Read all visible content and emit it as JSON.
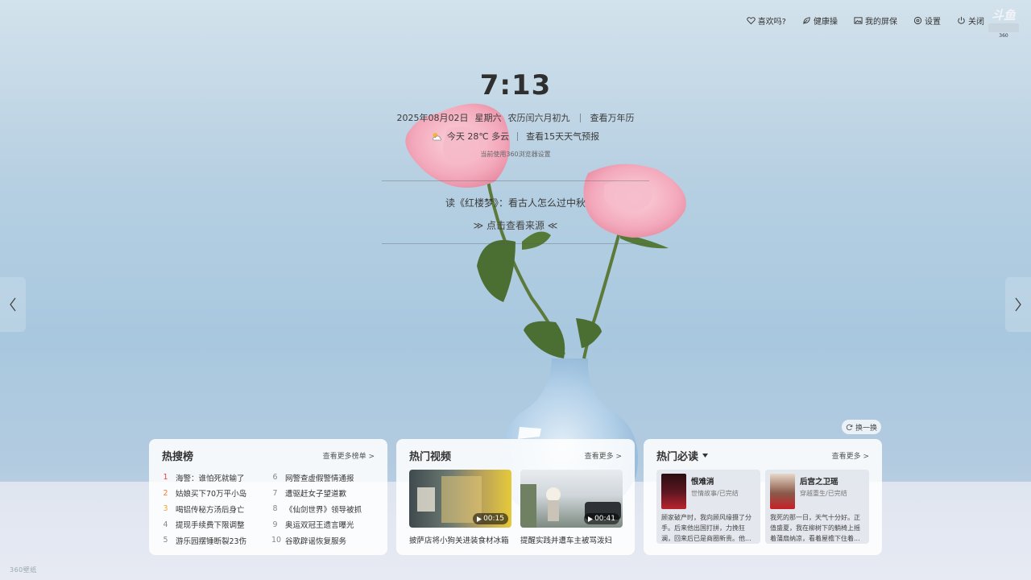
{
  "topbar": {
    "items": [
      {
        "label": "喜欢吗?",
        "icon": "heart-icon"
      },
      {
        "label": "健康操",
        "icon": "leaf-icon"
      },
      {
        "label": "我的屏保",
        "icon": "picture-icon"
      },
      {
        "label": "设置",
        "icon": "gear-icon"
      },
      {
        "label": "关闭",
        "icon": "power-icon"
      }
    ],
    "brand": {
      "logo_text": "斗鱼",
      "sub_text": "360"
    }
  },
  "clock": {
    "time": "7:13"
  },
  "date": {
    "date": "2025年08月02日",
    "weekday": "星期六",
    "lunar": "农历闰六月初九",
    "calendar_link": "查看万年历"
  },
  "weather": {
    "summary": "今天 28℃ 多云",
    "forecast_link": "查看15天天气预报"
  },
  "hint": "当前使用360浏览器设置",
  "story": {
    "title": "读《红楼梦》：看古人怎么过中秋",
    "link": "≫ 点击查看来源 ≪"
  },
  "refresh_label": "换一换",
  "hot_search": {
    "title": "热搜榜",
    "more": "查看更多榜单 >",
    "items": [
      {
        "rank": "1",
        "text": "海警：谁怕死就输了"
      },
      {
        "rank": "6",
        "text": "网警查虚假警情通报"
      },
      {
        "rank": "2",
        "text": "姑娘买下70万平小岛"
      },
      {
        "rank": "7",
        "text": "遭驱赶女子望道歉"
      },
      {
        "rank": "3",
        "text": "喝铝传秘方汤后身亡"
      },
      {
        "rank": "8",
        "text": "《仙剑世界》领导被抓"
      },
      {
        "rank": "4",
        "text": "提现手续费下限调整"
      },
      {
        "rank": "9",
        "text": "奥运双冠王遗言曝光"
      },
      {
        "rank": "5",
        "text": "游乐园摆锤断裂23伤"
      },
      {
        "rank": "10",
        "text": "谷歌辟谣恢复服务"
      }
    ]
  },
  "hot_video": {
    "title": "热门视频",
    "more": "查看更多 >",
    "items": [
      {
        "title": "披萨店将小狗关进装食材冰箱",
        "duration": "00:15"
      },
      {
        "title": "提醒实践并遭车主被骂泼妇",
        "duration": "00:41"
      }
    ]
  },
  "hot_read": {
    "title": "热门必读",
    "more": "查看更多 >",
    "items": [
      {
        "name": "恨难消",
        "meta": "世情故事/已完结",
        "desc": "顾家破产时，我向顾风缘摄了分手。后来他出国打拼，力挽狂澜，回来后已是商圈新贵。他..."
      },
      {
        "name": "后宫之卫瑶",
        "meta": "穿越重生/已完结",
        "desc": "我死的那一日，天气十分好。正值盛夏，我在柳树下的躺椅上摇着蒲扇纳凉，看着屋檐下住着..."
      }
    ]
  },
  "watermark": "360壁纸",
  "colors": {
    "accent_red": "#e8433a",
    "accent_orange": "#f27a2a",
    "accent_yellow": "#f2a32a"
  }
}
